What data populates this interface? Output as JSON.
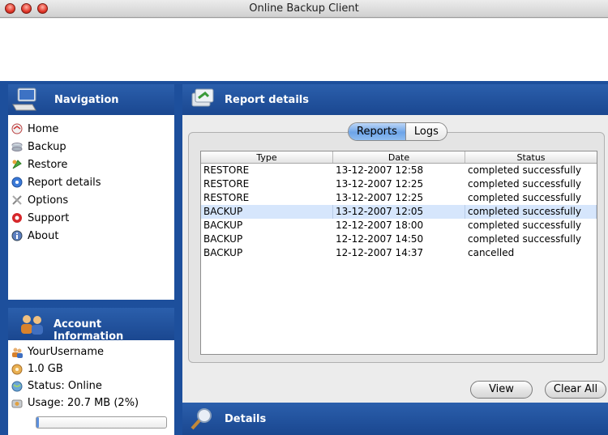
{
  "window": {
    "title": "Online Backup Client"
  },
  "navigation": {
    "title": "Navigation",
    "items": [
      {
        "label": "Home",
        "icon": "home-icon"
      },
      {
        "label": "Backup",
        "icon": "backup-icon"
      },
      {
        "label": "Restore",
        "icon": "restore-icon"
      },
      {
        "label": "Report details",
        "icon": "report-icon"
      },
      {
        "label": "Options",
        "icon": "options-icon"
      },
      {
        "label": "Support",
        "icon": "support-icon"
      },
      {
        "label": "About",
        "icon": "about-icon"
      }
    ]
  },
  "account": {
    "title": "Account Information",
    "username": "YourUsername",
    "quota": "1.0 GB",
    "status": "Status: Online",
    "usage": "Usage: 20.7 MB (2%)",
    "usage_fraction": 0.02
  },
  "report": {
    "title": "Report details",
    "tabs": [
      "Reports",
      "Logs"
    ],
    "active_tab": "Reports",
    "columns": [
      "Type",
      "Date",
      "Status"
    ],
    "rows": [
      {
        "type": "RESTORE",
        "date": "13-12-2007 12:58",
        "status": "completed successfully",
        "selected": false
      },
      {
        "type": "RESTORE",
        "date": "13-12-2007 12:25",
        "status": "completed successfully",
        "selected": false
      },
      {
        "type": "RESTORE",
        "date": "13-12-2007 12:25",
        "status": "completed successfully",
        "selected": false
      },
      {
        "type": "BACKUP",
        "date": "13-12-2007 12:05",
        "status": "completed successfully",
        "selected": true
      },
      {
        "type": "BACKUP",
        "date": "12-12-2007 18:00",
        "status": "completed successfully",
        "selected": false
      },
      {
        "type": "BACKUP",
        "date": "12-12-2007 14:50",
        "status": "completed successfully",
        "selected": false
      },
      {
        "type": "BACKUP",
        "date": "12-12-2007 14:37",
        "status": "cancelled",
        "selected": false
      }
    ],
    "buttons": {
      "view": "View",
      "clear_all": "Clear All"
    }
  },
  "details": {
    "title": "Details"
  },
  "colors": {
    "header_blue": "#1d4f9c",
    "selection": "#d6e6fc"
  }
}
